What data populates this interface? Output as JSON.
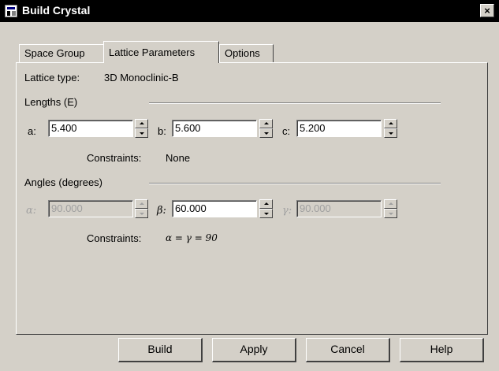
{
  "window": {
    "title": "Build Crystal",
    "close_glyph": "×"
  },
  "tabs": [
    {
      "label": "Space Group",
      "active": false
    },
    {
      "label": "Lattice Parameters",
      "active": true
    },
    {
      "label": "Options",
      "active": false
    }
  ],
  "lattice": {
    "type_label": "Lattice type:",
    "type_value": "3D Monoclinic-B"
  },
  "lengths": {
    "section_label": "Lengths (E)",
    "a_label": "a:",
    "a_value": "5.400",
    "b_label": "b:",
    "b_value": "5.600",
    "c_label": "c:",
    "c_value": "5.200",
    "constraints_label": "Constraints:",
    "constraints_value": "None"
  },
  "angles": {
    "section_label": "Angles (degrees)",
    "alpha_label": "α:",
    "alpha_value": "90.000",
    "alpha_enabled": false,
    "beta_label": "β:",
    "beta_value": "60.000",
    "beta_enabled": true,
    "gamma_label": "γ:",
    "gamma_value": "90.000",
    "gamma_enabled": false,
    "constraints_label": "Constraints:",
    "constraints_value": "α = γ = 90"
  },
  "buttons": {
    "build": "Build",
    "apply": "Apply",
    "cancel": "Cancel",
    "help": "Help"
  },
  "colors": {
    "titlebar": "#000000",
    "dialog_bg": "#d4d0c8",
    "disabled_text": "#a0a0a0"
  },
  "icons": {
    "title": "window-icon",
    "close": "close-icon",
    "spin_up": "chevron-up-icon",
    "spin_down": "chevron-down-icon"
  }
}
